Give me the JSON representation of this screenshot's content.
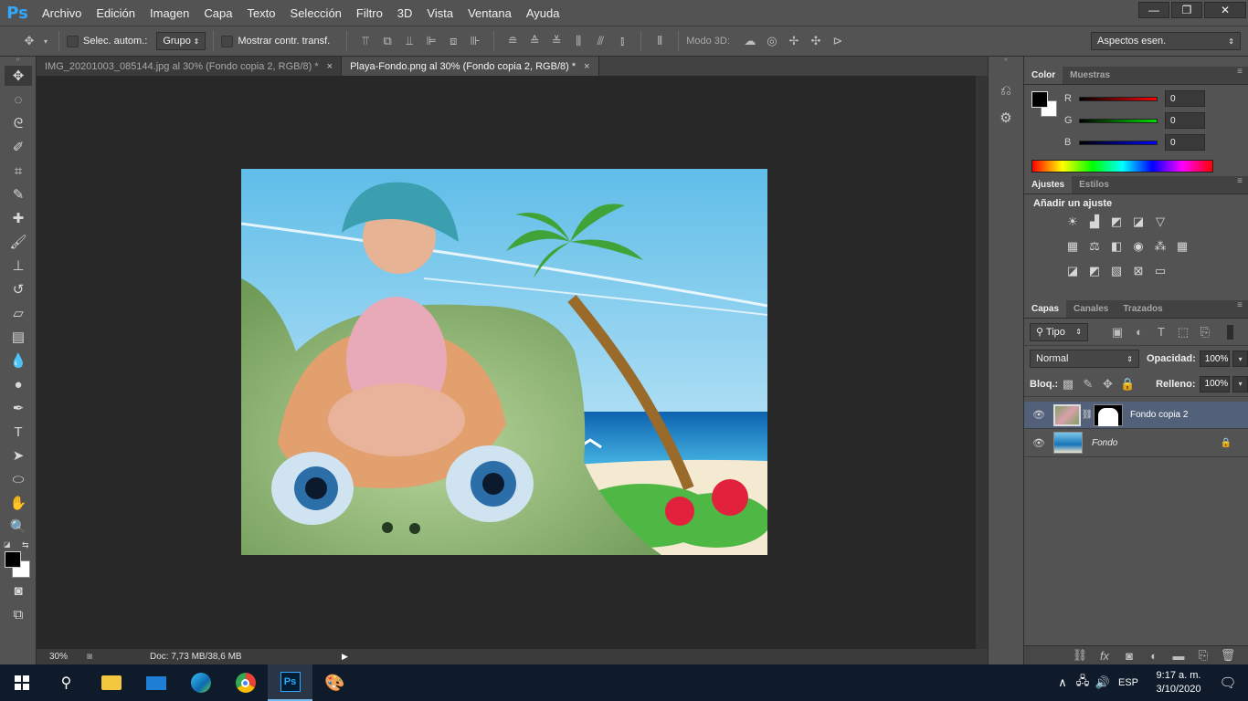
{
  "app": {
    "logo": "Ps"
  },
  "menu": [
    "Archivo",
    "Edición",
    "Imagen",
    "Capa",
    "Texto",
    "Selección",
    "Filtro",
    "3D",
    "Vista",
    "Ventana",
    "Ayuda"
  ],
  "window_controls": {
    "minimize": "—",
    "restore": "❐",
    "close": "✕"
  },
  "options": {
    "auto_select_label": "Selec. autom.:",
    "auto_select_value": "Grupo",
    "transform_label": "Mostrar contr. transf.",
    "mode3d_label": "Modo 3D:",
    "workspace": "Aspectos esen."
  },
  "tabs": [
    {
      "label": "IMG_20201003_085144.jpg al 30% (Fondo copia 2, RGB/8) *",
      "close": "×"
    },
    {
      "label": "Playa-Fondo.png al 30% (Fondo copia 2, RGB/8) *",
      "close": "×"
    }
  ],
  "status": {
    "zoom": "30%",
    "doc": "Doc: 7,73 MB/38,6 MB"
  },
  "color_panel": {
    "tabs": [
      "Color",
      "Muestras"
    ],
    "channels": [
      {
        "label": "R",
        "value": "0",
        "color": "#ff0000"
      },
      {
        "label": "G",
        "value": "0",
        "color": "#00d000"
      },
      {
        "label": "B",
        "value": "0",
        "color": "#0000ff"
      }
    ]
  },
  "adjust_panel": {
    "tabs": [
      "Ajustes",
      "Estilos"
    ],
    "title": "Añadir un ajuste"
  },
  "layers_panel": {
    "tabs": [
      "Capas",
      "Canales",
      "Trazados"
    ],
    "filter": "Tipo",
    "blend": "Normal",
    "opacity_label": "Opacidad:",
    "opacity": "100%",
    "lock_label": "Bloq.:",
    "fill_label": "Relleno:",
    "fill": "100%",
    "layers": [
      {
        "name": "Fondo copia 2",
        "selected": true
      },
      {
        "name": "Fondo",
        "locked": true
      }
    ]
  },
  "taskbar": {
    "lang": "ESP",
    "time": "9:17 a. m.",
    "date": "3/10/2020"
  }
}
